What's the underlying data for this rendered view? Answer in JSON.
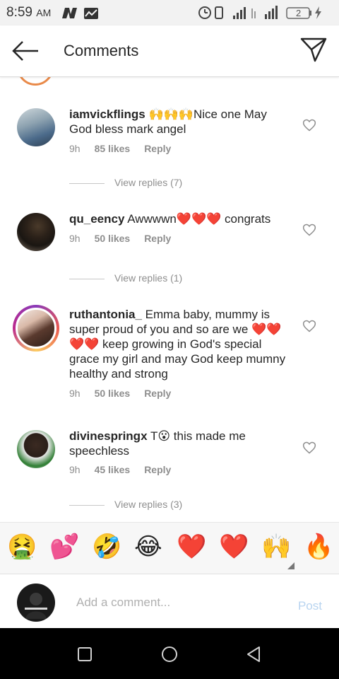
{
  "status": {
    "time": "8:59",
    "ampm": "AM",
    "battery": "2"
  },
  "header": {
    "title": "Comments"
  },
  "comments": [
    {
      "username": "iamvickflings",
      "text": " 🙌🙌🙌Nice one May God bless mark angel",
      "time": "9h",
      "likes": "85 likes",
      "reply": "Reply",
      "view_replies": "View replies (7)"
    },
    {
      "username": "qu_eency",
      "text": " Awwwwn❤️❤️❤️ congrats",
      "time": "9h",
      "likes": "50 likes",
      "reply": "Reply",
      "view_replies": "View replies (1)"
    },
    {
      "username": "ruthantonia_",
      "text": " Emma baby, mummy is super proud of you and so are we ❤️❤️❤️❤️ keep growing in God's special grace my girl and may God keep mumny healthy and strong",
      "time": "9h",
      "likes": "50 likes",
      "reply": "Reply"
    },
    {
      "username": "divinespringx",
      "text": " T😮 this made me speechless",
      "time": "9h",
      "likes": "45 likes",
      "reply": "Reply",
      "view_replies": "View replies (3)"
    }
  ],
  "emojis": [
    "🤮",
    "💕",
    "🤣",
    "😂",
    "❤️",
    "❤️",
    "🙌",
    "🔥"
  ],
  "add_comment": {
    "placeholder": "Add a comment...",
    "post_label": "Post"
  },
  "colors": {
    "accent": "#3897f0",
    "post_disabled": "#b8d4f0",
    "story_ring": "#e95950"
  }
}
